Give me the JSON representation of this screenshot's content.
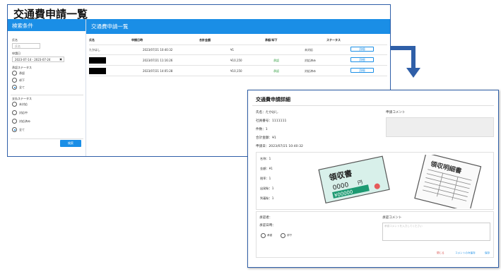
{
  "list_window": {
    "title": "交通費申請一覧",
    "search_panel": {
      "header": "検索条件",
      "name_label": "氏名",
      "name_placeholder": "氏名",
      "date_label": "申請日",
      "date_value": "2023-07-14 - 2023-07-24",
      "approval_status_label": "承認ステータス",
      "approval_options": [
        {
          "label": "承認",
          "selected": false
        },
        {
          "label": "却下",
          "selected": false
        },
        {
          "label": "全て",
          "selected": true
        }
      ],
      "payment_status_label": "支払ステータス",
      "payment_options": [
        {
          "label": "未対応",
          "selected": false
        },
        {
          "label": "対応中",
          "selected": false
        },
        {
          "label": "対応済み",
          "selected": false
        },
        {
          "label": "全て",
          "selected": true
        }
      ],
      "search_button": "検索"
    },
    "table_panel": {
      "header": "交通費申請一覧",
      "columns": [
        "氏名",
        "申請日時",
        "合計金額",
        "承認/却下",
        "ステータス"
      ],
      "rows": [
        {
          "name": "たかはし",
          "redacted": false,
          "datetime": "2023/07/21 10:40:32",
          "amount": "¥1",
          "approval": "",
          "status": "未対応",
          "detail": "詳細"
        },
        {
          "name": "",
          "redacted": true,
          "datetime": "2023/07/21 11:16:26",
          "amount": "¥10,150",
          "approval": "承認",
          "status": "対応済み",
          "detail": "詳細"
        },
        {
          "name": "",
          "redacted": true,
          "datetime": "2023/07/21 14:05:28",
          "amount": "¥10,150",
          "approval": "承認",
          "status": "対応済み",
          "detail": "詳細"
        }
      ]
    }
  },
  "arrow_icon": "arrow-down-right-icon",
  "detail_window": {
    "title": "交通費申請詳細",
    "name": "氏名：たかはし",
    "employee_no": "社員番号：1111111",
    "count": "件数：1",
    "total": "合計金額：¥1",
    "applied_at": "申請日：2023/07/21 10:40:32",
    "comment_label": "申請コメント",
    "receipt": {
      "fields": [
        "名称：1",
        "金額：¥1",
        "税率：1",
        "出発駅：1",
        "到着駅：1"
      ],
      "receipt_text": "領収書",
      "receipt_amount": "0000",
      "receipt_yen": "円",
      "receipt_digits": "¥00000",
      "statement_text": "領収明細書"
    },
    "approver_label": "承認者：",
    "approved_at_label": "承認日時：",
    "approval_options": [
      "承認",
      "却下"
    ],
    "approval_comment_label": "承認コメント",
    "approval_comment_placeholder": "承認コメントを入力してください",
    "footer_links": [
      {
        "label": "閉じる",
        "color": "#d9534f"
      },
      {
        "label": "コメントのみ保存",
        "color": "#1a8ee6"
      },
      {
        "label": "保存",
        "color": "#1a8ee6"
      }
    ]
  },
  "colors": {
    "accent": "#1a8ee6",
    "border": "#2f5fa8",
    "success": "#2a9a3a",
    "danger": "#d9534f"
  }
}
